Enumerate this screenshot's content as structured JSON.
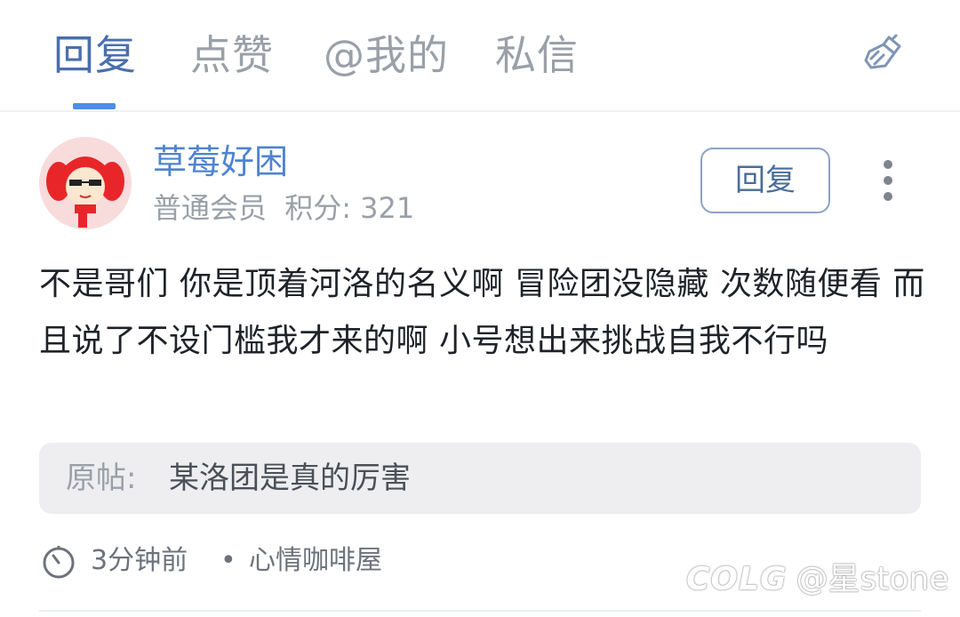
{
  "tabs": [
    {
      "label": "回复",
      "active": true
    },
    {
      "label": "点赞",
      "active": false
    },
    {
      "label": "@我的",
      "active": false
    },
    {
      "label": "私信",
      "active": false
    }
  ],
  "toolbar": {
    "clear_icon": "broom-icon"
  },
  "post": {
    "username": "草莓好困",
    "user_level": "普通会员",
    "points": "积分: 321",
    "reply_button": "回复",
    "more_icon": "more-vertical-icon",
    "content": "不是哥们 你是顶着河洛的名义啊 冒险团没隐藏 次数随便看 而且说了不设门槛我才来的啊 小号想出来挑战自我不行吗",
    "quote_label": "原帖:",
    "quote_text": "某洛团是真的厉害",
    "time": "3分钟前",
    "separator": "•",
    "board": "心情咖啡屋"
  },
  "watermark": {
    "logo": "COLG",
    "handle": "@星stone"
  },
  "colors": {
    "accent": "#4d8ee6",
    "active_tab": "#4a6fae",
    "username": "#4f84d0",
    "muted": "#9aa0a8"
  }
}
